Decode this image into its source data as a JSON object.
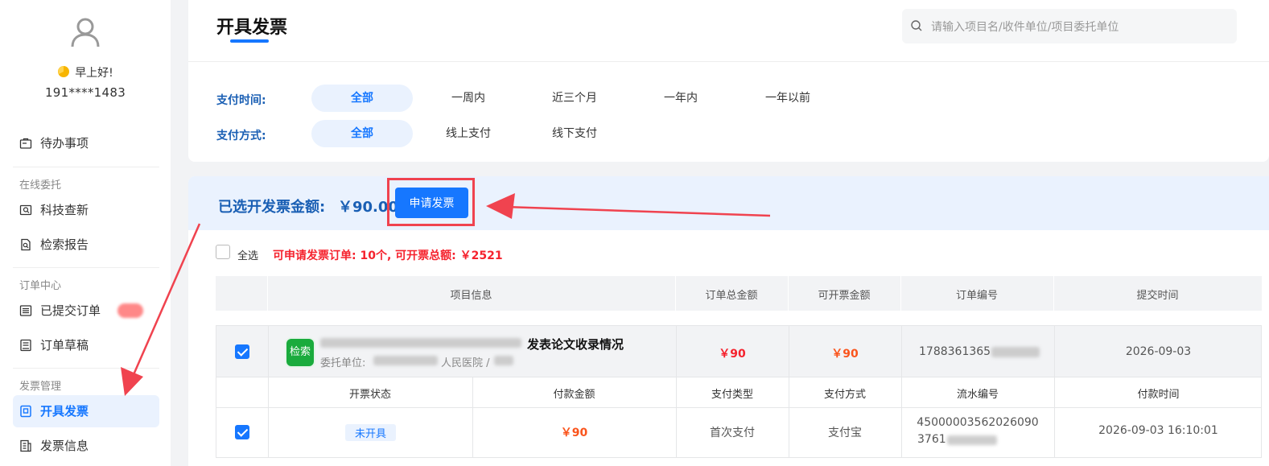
{
  "user": {
    "greeting": "早上好!",
    "phone": "191****1483"
  },
  "sidebar": {
    "todo": "待办事项",
    "sections": {
      "online": "在线委托",
      "orders": "订单中心",
      "invoice": "发票管理"
    },
    "items": {
      "tech_search": "科技查新",
      "search_report": "检索报告",
      "submitted_orders": "已提交订单",
      "order_drafts": "订单草稿",
      "issue_invoice": "开具发票",
      "invoice_info": "发票信息"
    }
  },
  "header": {
    "title": "开具发票",
    "search_placeholder": "请输入项目名/收件单位/项目委托单位"
  },
  "filters": {
    "pay_time_label": "支付时间:",
    "pay_time_options": [
      "全部",
      "一周内",
      "近三个月",
      "一年内",
      "一年以前"
    ],
    "pay_method_label": "支付方式:",
    "pay_method_options": [
      "全部",
      "线上支付",
      "线下支付"
    ]
  },
  "selection": {
    "label": "已选开发票金额:",
    "amount": "￥90.00",
    "apply_button": "申请发票"
  },
  "list": {
    "select_all": "全选",
    "available_summary": "可申请发票订单: 10个, 可开票总额: ￥2521",
    "columns": [
      "项目信息",
      "订单总金额",
      "可开票金额",
      "订单编号",
      "提交时间"
    ],
    "order": {
      "logo_text": "检索",
      "title_suffix": "发表论文收录情况",
      "client_label": "委托单位:",
      "client_partial": "人民医院 /",
      "total": "￥90",
      "invoiceable": "￥90",
      "order_no": "1788361365",
      "submitted": "2026-09-03"
    },
    "pay_columns": [
      "开票状态",
      "付款金额",
      "支付类型",
      "支付方式",
      "流水编号",
      "付款时间"
    ],
    "payment": {
      "status": "未开具",
      "amount": "￥90",
      "pay_type": "首次支付",
      "pay_method": "支付宝",
      "serial_line1": "45000003562026090",
      "serial_line2": "3761",
      "paid_at": "2026-09-03 16:10:01"
    }
  },
  "colors": {
    "primary": "#1677ff",
    "danger": "#f5222d",
    "amount_orange": "#fa541c",
    "annotation_red": "#f0434f"
  }
}
